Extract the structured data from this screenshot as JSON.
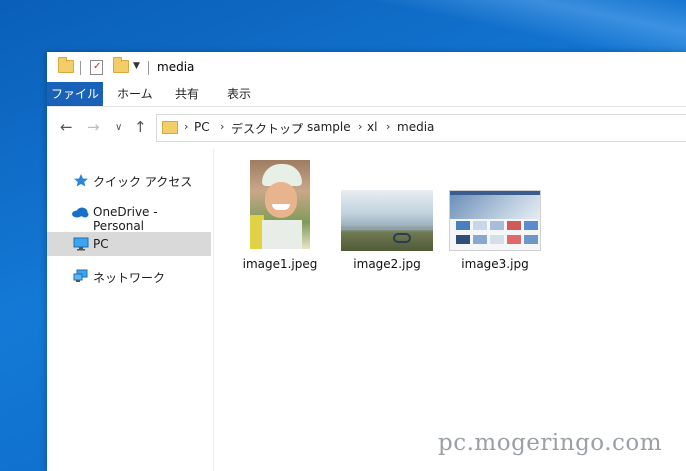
{
  "window": {
    "title": "media"
  },
  "ribbon": {
    "tabs": [
      "ファイル",
      "ホーム",
      "共有",
      "表示"
    ]
  },
  "address": {
    "crumbs": [
      "PC",
      "デスクトップ",
      "sample",
      "xl",
      "media"
    ]
  },
  "sidebar": {
    "items": [
      {
        "label": "クイック アクセス",
        "icon": "star-icon"
      },
      {
        "label": "OneDrive - Personal",
        "icon": "onedrive-cloud-icon"
      },
      {
        "label": "PC",
        "icon": "pc-monitor-icon",
        "selected": true
      },
      {
        "label": "ネットワーク",
        "icon": "network-icon"
      }
    ]
  },
  "files": [
    {
      "name": "image1.jpeg",
      "icon": "photo-child-thumbnail"
    },
    {
      "name": "image2.jpg",
      "icon": "photo-landscape-thumbnail"
    },
    {
      "name": "image3.jpg",
      "icon": "webpage-screenshot-thumbnail"
    }
  ],
  "watermark": "pc.mogeringo.com",
  "colors": {
    "accent": "#1a62b8",
    "selected_bg": "#d9d9d9"
  }
}
